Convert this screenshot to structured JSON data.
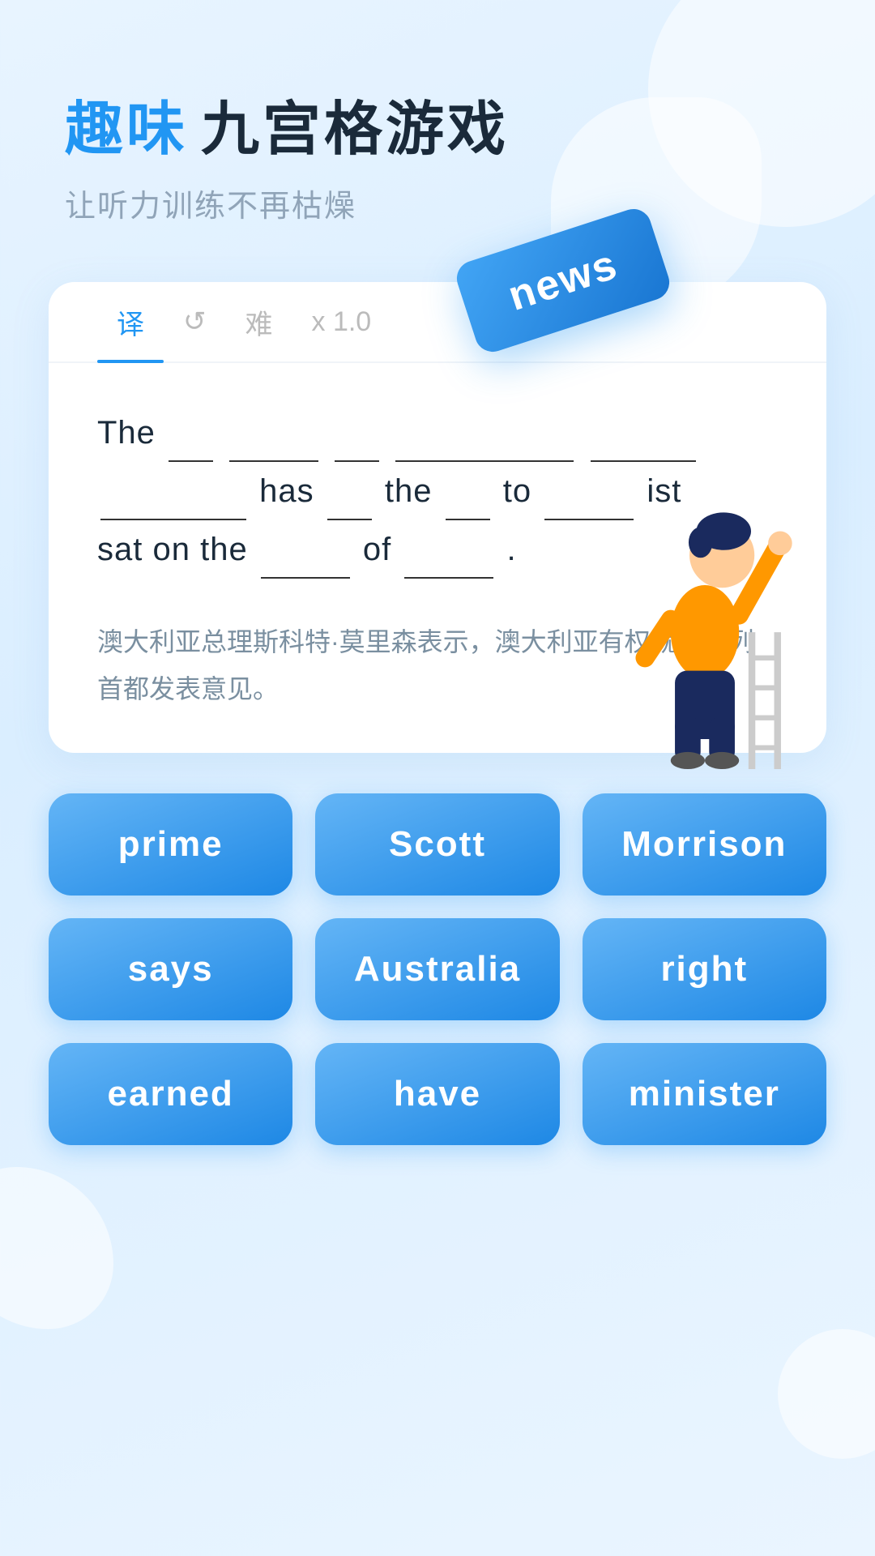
{
  "header": {
    "title_accent": "趣味",
    "title_main": "九宫格游戏",
    "subtitle": "让听力训练不再枯燥"
  },
  "tabs": [
    {
      "id": "translate",
      "label": "译",
      "active": true
    },
    {
      "id": "replay",
      "label": "↺",
      "active": false
    },
    {
      "id": "difficulty",
      "label": "难",
      "active": false
    },
    {
      "id": "speed",
      "label": "x 1.0",
      "active": false
    }
  ],
  "sentence": {
    "text_display": "The ___ ______ ___ _________ _____ ________ has ___ the ___ to _____ ist sat on the ____ of _____ .",
    "translation": "澳大利亚总理斯科特·莫里森表示，澳大利亚有权就以色列首都发表意见。"
  },
  "floating_word": "news",
  "word_buttons": [
    "prime",
    "Scott",
    "Morrison",
    "says",
    "Australia",
    "right",
    "earned",
    "have",
    "minister"
  ]
}
